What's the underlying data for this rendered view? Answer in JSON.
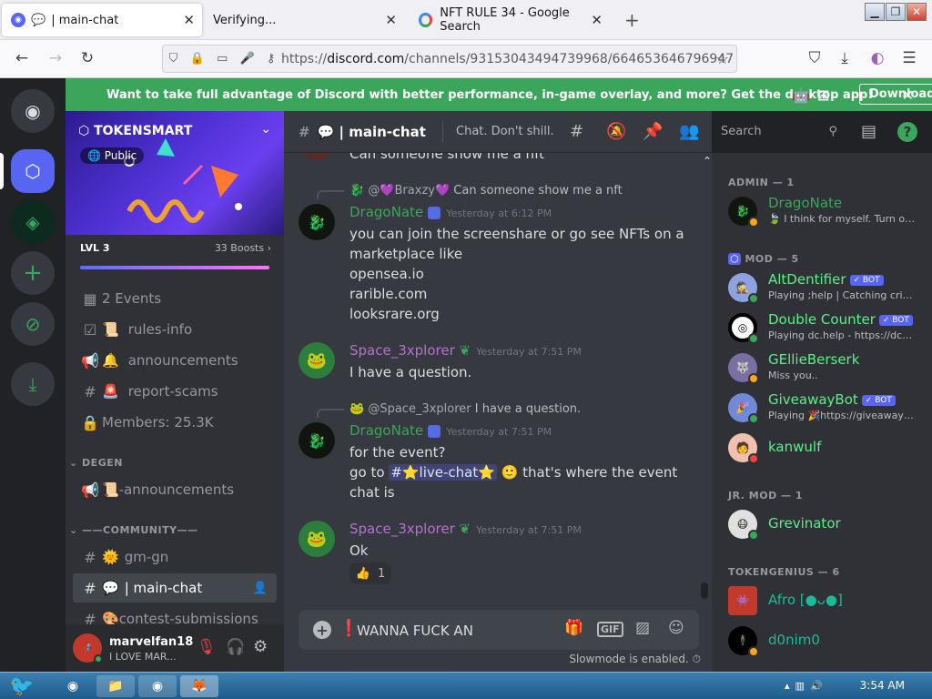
{
  "browser": {
    "tabs": [
      {
        "label": "| main-chat",
        "close": "✕"
      },
      {
        "label": "Verifying...",
        "close": "✕"
      },
      {
        "label": "NFT RULE 34 - Google Search",
        "close": "✕"
      }
    ],
    "new_tab": "+",
    "url_prefix": "https://",
    "url_host": "discord.com",
    "url_path": "/channels/931530434947399​68/664653646796947"
  },
  "banner": {
    "text": "Want to take full advantage of Discord with better performance, in-game overlay, and more? Get the desktop app!",
    "download_label": "Download"
  },
  "server": {
    "name": "TOKENSMART",
    "visibility": "Public",
    "level": "LVL 3",
    "boosts": "33 Boosts"
  },
  "channels": [
    {
      "icon": "calendar-icon",
      "label": "2 Events"
    },
    {
      "icon": "checkbox-icon",
      "label": "rules-info"
    },
    {
      "icon": "megaphone-icon",
      "label": "announcements"
    },
    {
      "icon": "hash-icon",
      "label": "report-scams"
    },
    {
      "icon": "lock-icon",
      "label": "Members: 25.3K"
    }
  ],
  "categories": {
    "degen": "DEGEN",
    "community": "——COMMUNITY——"
  },
  "degen_channels": [
    {
      "label": "-announcements"
    }
  ],
  "community_channels": [
    {
      "label": "gm-gn"
    },
    {
      "label": "| main-chat"
    },
    {
      "label": "contest-submissions"
    }
  ],
  "user": {
    "name": "marvelfan18",
    "status": "I LOVE MAR..."
  },
  "chat": {
    "channel_title": "| main-chat",
    "topic": "Chat. Don't shill.",
    "search_placeholder": "Search",
    "cutoff_line": "Can someone show me a nft",
    "messages": [
      {
        "reply_author": "@💜Braxzy💜",
        "reply_text": "Can someone show me a nft",
        "author": "DragoNate",
        "time": "Yesterday at 6:12 PM",
        "lines": [
          "you can join the screenshare or go see NFTs on a",
          "marketplace like",
          "opensea.io",
          "rarible.com",
          "looksrare.org"
        ]
      },
      {
        "author": "Space_3xplorer",
        "time": "Yesterday at 7:51 PM",
        "lines": [
          "I have a question."
        ]
      },
      {
        "reply_author": "@Space_3xplorer",
        "reply_text": "I have a question.",
        "author": "DragoNate",
        "time": "Yesterday at 7:51 PM",
        "line1": "for the event?",
        "line2_pre": "go to",
        "mention": "#⭐live-chat⭐",
        "line2_post": "that's where the event",
        "line3": "chat is"
      },
      {
        "author": "Space_3xplorer",
        "time": "Yesterday at 7:51 PM",
        "lines": [
          "Ok"
        ],
        "reaction_emoji": "👍",
        "reaction_count": "1"
      }
    ],
    "composer_value": "WANNA FUCK AN",
    "slowmode": "Slowmode is enabled."
  },
  "members": {
    "groups": [
      {
        "label": "ADMIN — 1"
      },
      {
        "label": "MOD — 5"
      },
      {
        "label": "JR. MOD — 1"
      },
      {
        "label": "TOKENGENIUS — 6"
      }
    ],
    "admin": [
      {
        "name": "DragoNate",
        "activity": "🍃 I think for myself. Turn off ...",
        "color": "#3ba55c"
      }
    ],
    "mods": [
      {
        "name": "AltDentifier",
        "bot": "BOT",
        "activity": "Playing ;help | Catching crimin...",
        "color": "#57f287"
      },
      {
        "name": "Double Counter",
        "bot": "BOT",
        "activity": "Playing dc.help - https://dcoun...",
        "color": "#57f287"
      },
      {
        "name": "GEllieBerserk",
        "activity": "Miss you..",
        "color": "#57f287"
      },
      {
        "name": "GiveawayBot",
        "bot": "BOT",
        "activity": "Playing 🎉https://giveawaybo...",
        "color": "#57f287"
      },
      {
        "name": "kanwulf",
        "activity": "",
        "color": "#57f287"
      }
    ],
    "jrmod": [
      {
        "name": "Grevinator",
        "color": "#57f287"
      }
    ],
    "genius": [
      {
        "name": "Afro [●ᴗ●]",
        "color": "#1abc9c"
      },
      {
        "name": "d0nim0",
        "color": "#1abc9c"
      }
    ]
  },
  "taskbar": {
    "clock": "3:54 AM"
  }
}
